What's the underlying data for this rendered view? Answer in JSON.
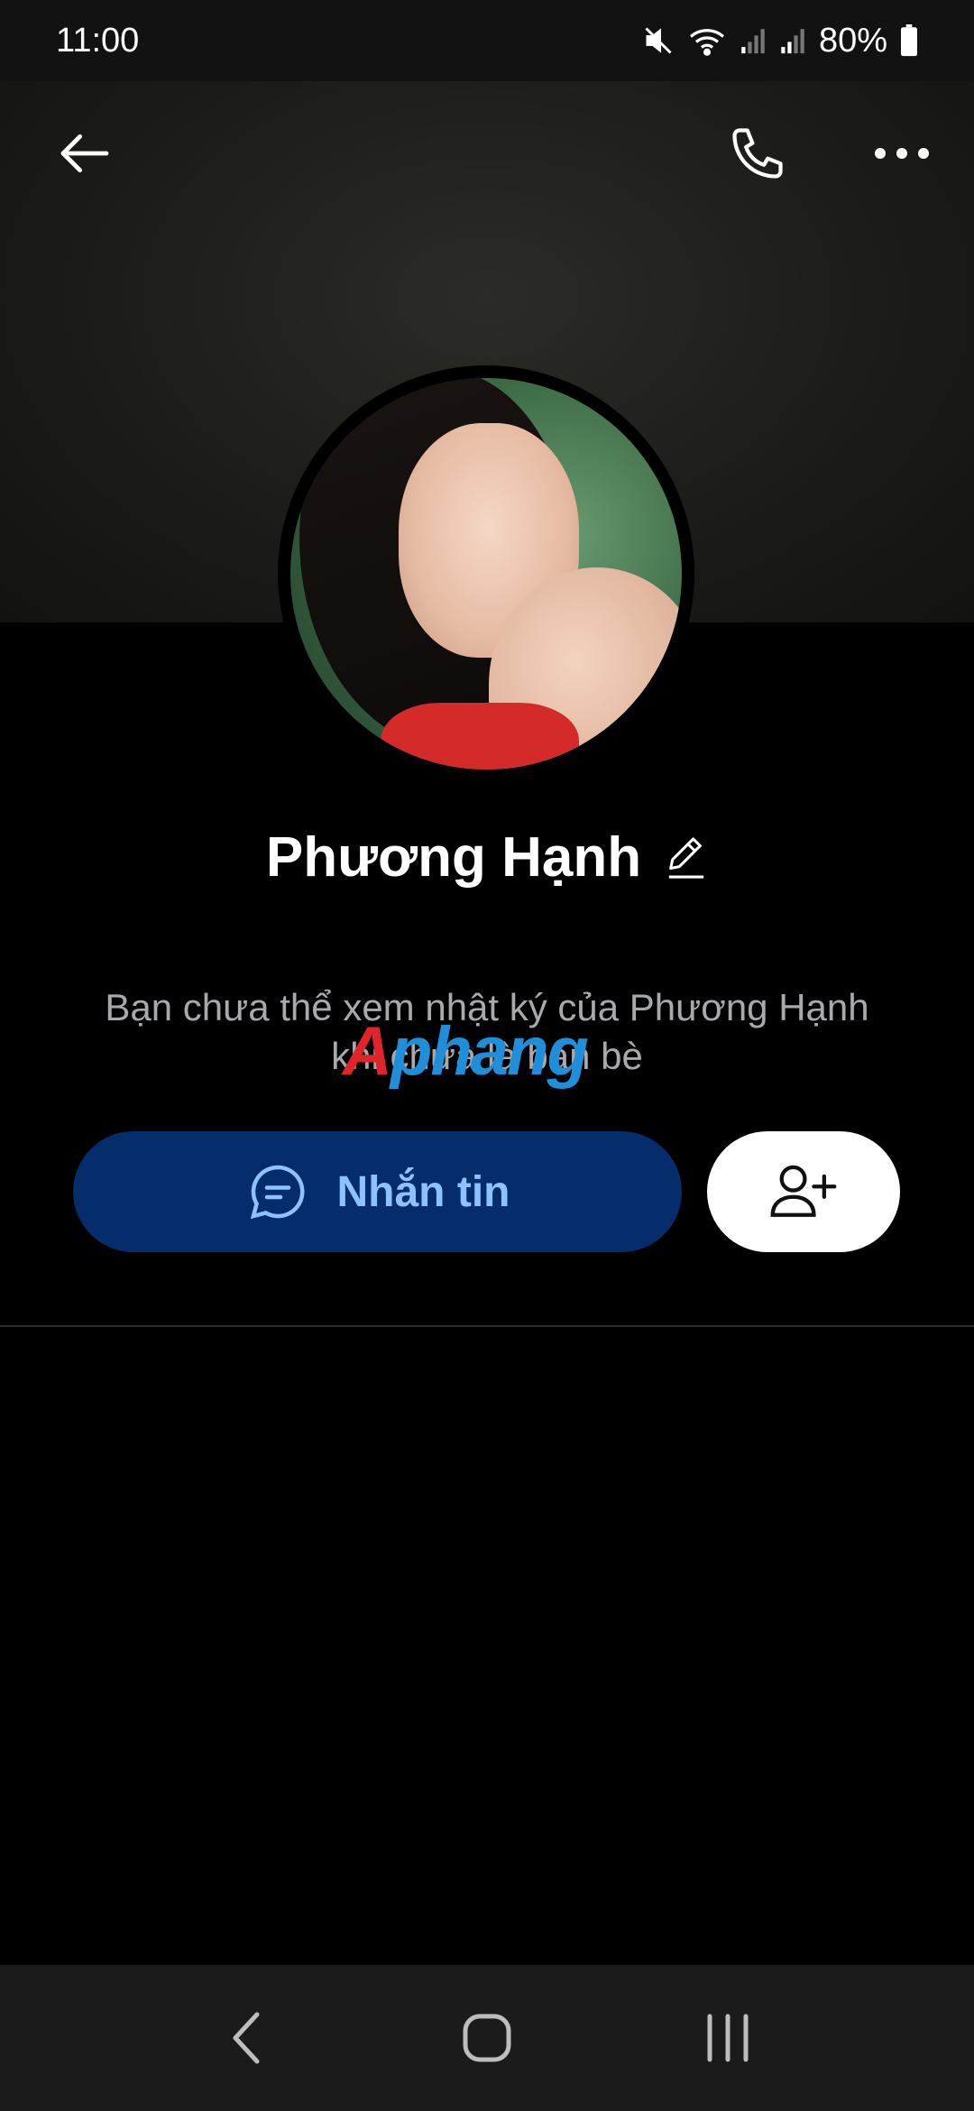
{
  "status_bar": {
    "time": "11:00",
    "battery": "80%",
    "icons": [
      "mute-icon",
      "wifi-icon",
      "signal-icon",
      "signal-icon",
      "battery-icon"
    ]
  },
  "header": {
    "icons": [
      "back-arrow-icon",
      "phone-icon",
      "more-icon"
    ]
  },
  "profile": {
    "name": "Phương Hạnh",
    "notice": "Bạn chưa thể xem nhật ký của Phương Hạnh khi chưa là bạn bè"
  },
  "watermark": {
    "first": "A",
    "rest": "phang"
  },
  "actions": {
    "message_label": "Nhắn tin",
    "message_icon": "chat-bubble-icon",
    "add_friend_icon": "add-user-icon"
  },
  "colors": {
    "message_button_bg": "#052d6b",
    "message_button_text": "#8fc1ff"
  },
  "navigation": {
    "icons": [
      "nav-back-icon",
      "nav-home-icon",
      "nav-recents-icon"
    ]
  }
}
